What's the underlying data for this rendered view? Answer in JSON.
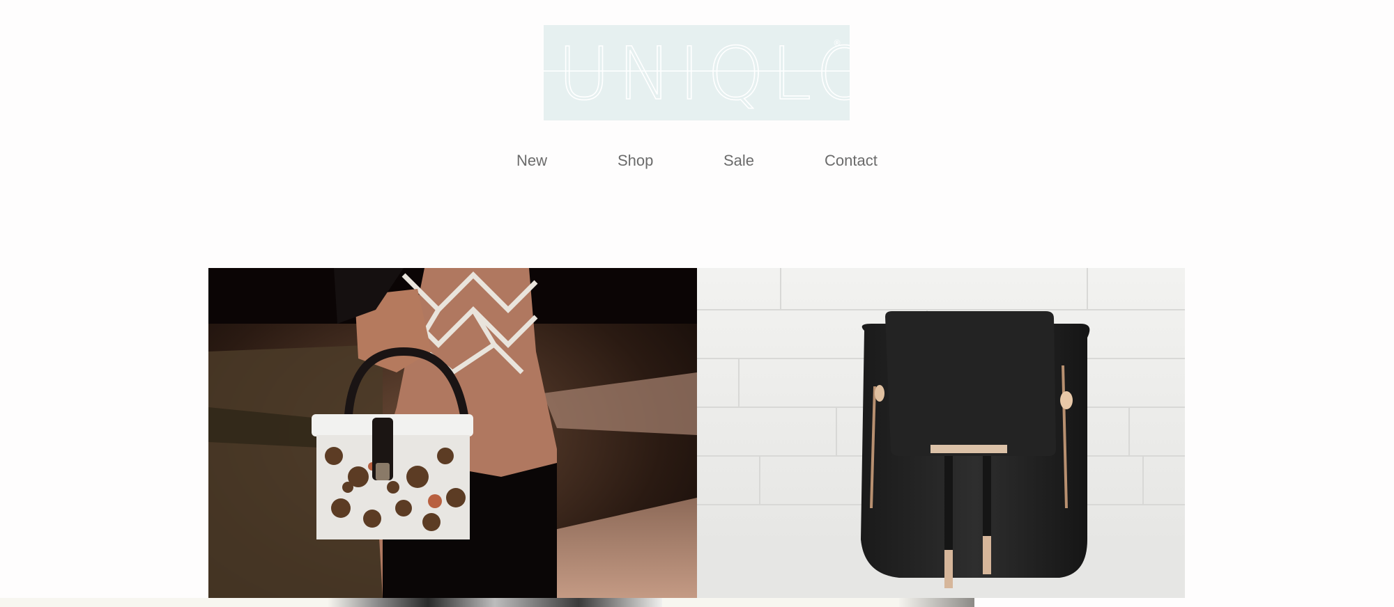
{
  "brand": {
    "logo_text": "UNIQLO"
  },
  "nav": {
    "items": [
      {
        "label": "New"
      },
      {
        "label": "Shop"
      },
      {
        "label": "Sale"
      },
      {
        "label": "Contact"
      }
    ]
  },
  "gallery": {
    "items": [
      {
        "name": "embellished-box-handbag"
      },
      {
        "name": "black-leather-backpack"
      }
    ]
  },
  "colors": {
    "page_bg": "#fefdfd",
    "logo_bg": "#e6f0f0",
    "logo_stroke": "#ffffff",
    "nav_text": "#6b6b6b"
  }
}
